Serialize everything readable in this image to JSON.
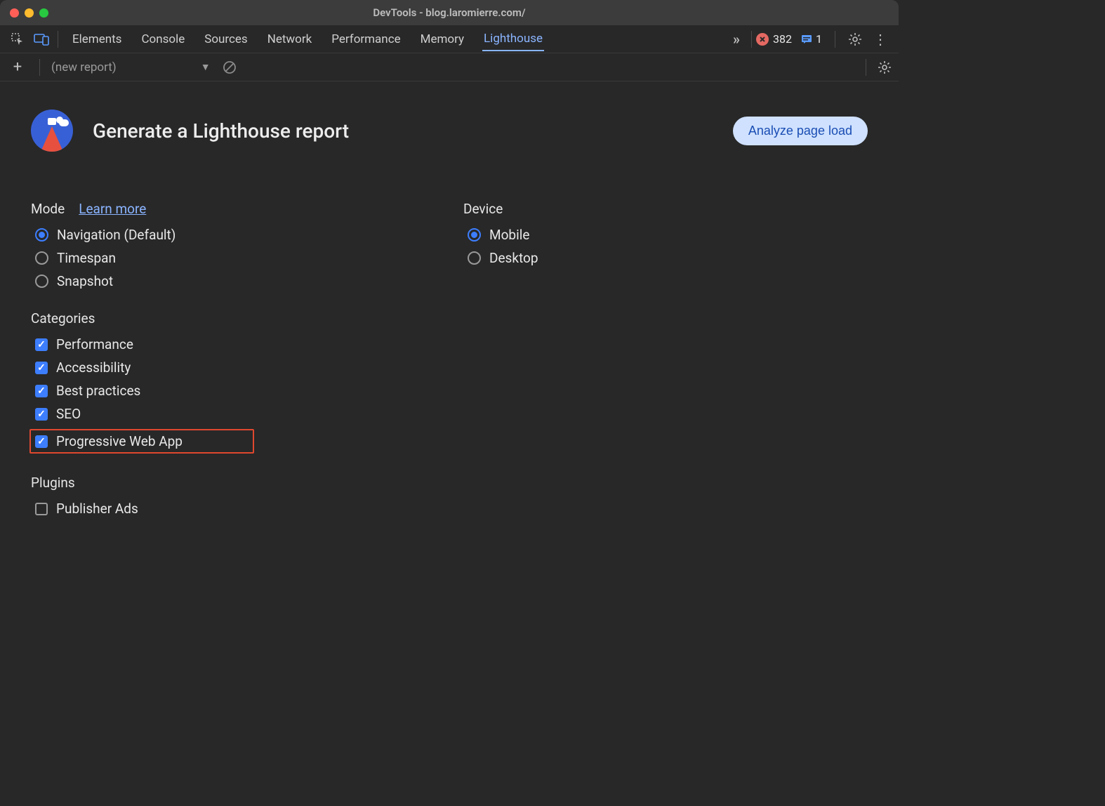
{
  "window": {
    "title": "DevTools - blog.laromierre.com/"
  },
  "tabs": {
    "items": [
      "Elements",
      "Console",
      "Sources",
      "Network",
      "Performance",
      "Memory",
      "Lighthouse"
    ],
    "active_index": 6
  },
  "toolbar_right": {
    "error_count": "382",
    "message_count": "1"
  },
  "toolbar2": {
    "report_label": "(new report)"
  },
  "lighthouse": {
    "title": "Generate a Lighthouse report",
    "analyze_button": "Analyze page load",
    "mode_label": "Mode",
    "learn_more": "Learn more",
    "modes": [
      {
        "label": "Navigation (Default)",
        "checked": true
      },
      {
        "label": "Timespan",
        "checked": false
      },
      {
        "label": "Snapshot",
        "checked": false
      }
    ],
    "device_label": "Device",
    "devices": [
      {
        "label": "Mobile",
        "checked": true
      },
      {
        "label": "Desktop",
        "checked": false
      }
    ],
    "categories_label": "Categories",
    "categories": [
      {
        "label": "Performance",
        "checked": true
      },
      {
        "label": "Accessibility",
        "checked": true
      },
      {
        "label": "Best practices",
        "checked": true
      },
      {
        "label": "SEO",
        "checked": true
      },
      {
        "label": "Progressive Web App",
        "checked": true,
        "highlight": true
      }
    ],
    "plugins_label": "Plugins",
    "plugins": [
      {
        "label": "Publisher Ads",
        "checked": false
      }
    ]
  }
}
